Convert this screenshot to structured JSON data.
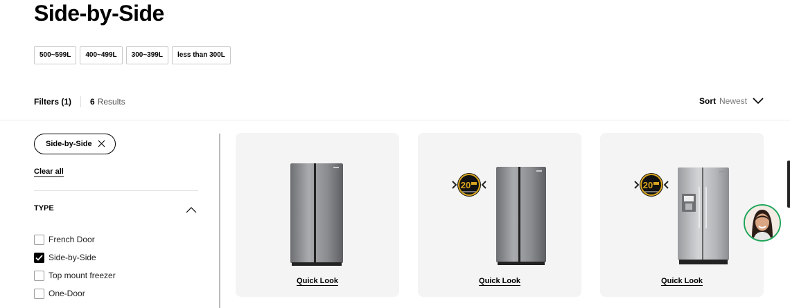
{
  "page": {
    "title": "Side-by-Side"
  },
  "capacity_chips": [
    "500~599L",
    "400~499L",
    "300~399L",
    "less than 300L"
  ],
  "toolbar": {
    "filters_label": "Filters (1)",
    "results_count": "6",
    "results_label": "Results",
    "sort_label": "Sort",
    "sort_value": "Newest"
  },
  "sidebar": {
    "active_filter": "Side-by-Side",
    "clear_all": "Clear all",
    "type_heading": "TYPE",
    "type_options": [
      {
        "label": "French Door",
        "checked": false
      },
      {
        "label": "Side-by-Side",
        "checked": true
      },
      {
        "label": "Top mount freezer",
        "checked": false
      },
      {
        "label": "One-Door",
        "checked": false
      }
    ]
  },
  "products": [
    {
      "quick_look": "Quick Look"
    },
    {
      "quick_look": "Quick Look",
      "badge": "20"
    },
    {
      "quick_look": "Quick Look",
      "badge": "20"
    }
  ],
  "icons": {
    "close": "close-icon",
    "sort_chevron": "chevron-down-icon",
    "type_chevron": "chevron-up-icon",
    "checkmark": "checkmark-icon",
    "chat": "chat-assistant-avatar"
  },
  "colors": {
    "card_bg": "#f4f4f4",
    "badge_gold": "#d9a520",
    "chat_ring": "#1ea65a"
  }
}
